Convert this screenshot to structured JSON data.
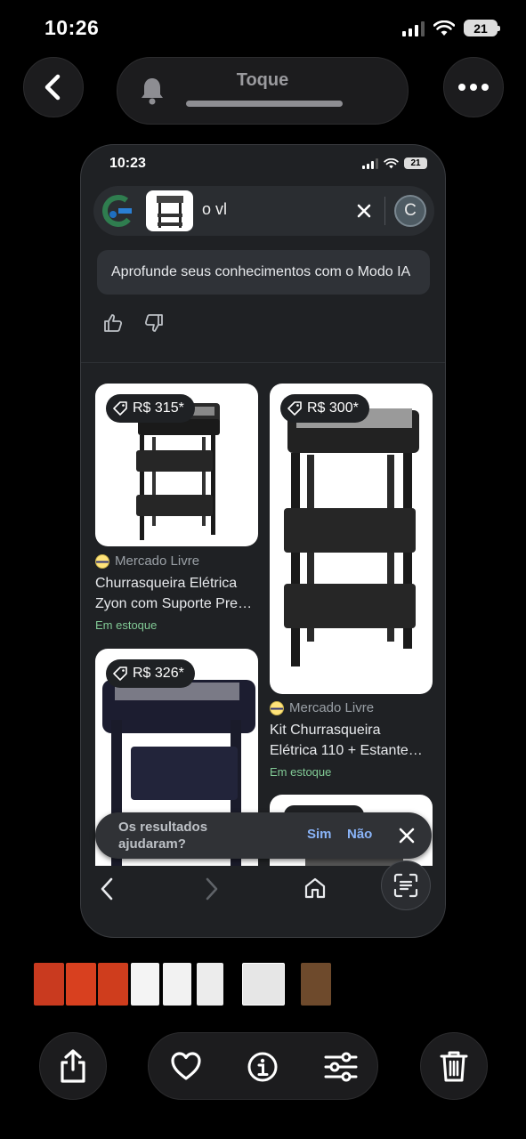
{
  "status_bar": {
    "time": "10:26",
    "battery": "21"
  },
  "top_bar": {
    "title": "Toque"
  },
  "inner": {
    "status": {
      "time": "10:23",
      "battery": "21"
    },
    "search": {
      "query": "o vl",
      "avatar_initial": "C"
    },
    "ai_chip": "Aprofunde seus conhecimentos com o Modo IA",
    "results": [
      {
        "price": "R$ 315*",
        "source": "Mercado Livre",
        "title_line1": "Churrasqueira Elétrica",
        "title_line2": "Zyon com Suporte Pre…",
        "stock": "Em estoque"
      },
      {
        "price": "R$ 300*",
        "source": "Mercado Livre",
        "title_line1": "Kit Churrasqueira",
        "title_line2": "Elétrica 110 + Estante…",
        "stock": "Em estoque"
      },
      {
        "price": "R$ 326*"
      }
    ],
    "feedback": {
      "question_line1": "Os resultados",
      "question_line2": "ajudaram?",
      "yes": "Sim",
      "no": "Não"
    }
  },
  "colors": {
    "accent_link": "#8ab4f8",
    "stock_green": "#81c995",
    "background": "#000000"
  }
}
